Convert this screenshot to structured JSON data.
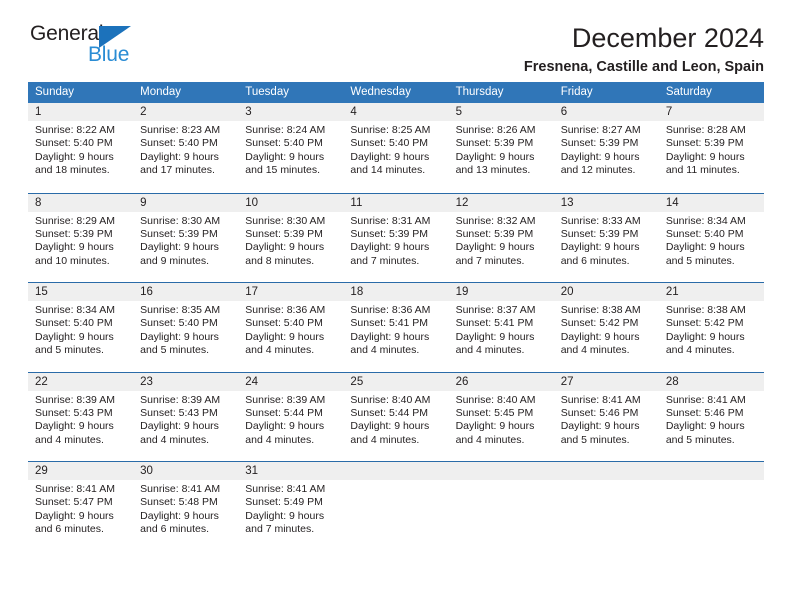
{
  "logo": {
    "text_top": "General",
    "text_bottom": "Blue",
    "triangle_color": "#1c72bb",
    "blue_color": "#2a8cd4"
  },
  "header": {
    "month_title": "December 2024",
    "location": "Fresnena, Castille and Leon, Spain"
  },
  "colors": {
    "header_band": "#3076b8",
    "row_divider": "#2a6ba8",
    "day_number_band": "#efefef",
    "text": "#231f20"
  },
  "calendar": {
    "weekdays": [
      "Sunday",
      "Monday",
      "Tuesday",
      "Wednesday",
      "Thursday",
      "Friday",
      "Saturday"
    ],
    "weeks": [
      [
        {
          "day": "1",
          "sunrise": "Sunrise: 8:22 AM",
          "sunset": "Sunset: 5:40 PM",
          "daylight_line1": "Daylight: 9 hours",
          "daylight_line2": "and 18 minutes."
        },
        {
          "day": "2",
          "sunrise": "Sunrise: 8:23 AM",
          "sunset": "Sunset: 5:40 PM",
          "daylight_line1": "Daylight: 9 hours",
          "daylight_line2": "and 17 minutes."
        },
        {
          "day": "3",
          "sunrise": "Sunrise: 8:24 AM",
          "sunset": "Sunset: 5:40 PM",
          "daylight_line1": "Daylight: 9 hours",
          "daylight_line2": "and 15 minutes."
        },
        {
          "day": "4",
          "sunrise": "Sunrise: 8:25 AM",
          "sunset": "Sunset: 5:40 PM",
          "daylight_line1": "Daylight: 9 hours",
          "daylight_line2": "and 14 minutes."
        },
        {
          "day": "5",
          "sunrise": "Sunrise: 8:26 AM",
          "sunset": "Sunset: 5:39 PM",
          "daylight_line1": "Daylight: 9 hours",
          "daylight_line2": "and 13 minutes."
        },
        {
          "day": "6",
          "sunrise": "Sunrise: 8:27 AM",
          "sunset": "Sunset: 5:39 PM",
          "daylight_line1": "Daylight: 9 hours",
          "daylight_line2": "and 12 minutes."
        },
        {
          "day": "7",
          "sunrise": "Sunrise: 8:28 AM",
          "sunset": "Sunset: 5:39 PM",
          "daylight_line1": "Daylight: 9 hours",
          "daylight_line2": "and 11 minutes."
        }
      ],
      [
        {
          "day": "8",
          "sunrise": "Sunrise: 8:29 AM",
          "sunset": "Sunset: 5:39 PM",
          "daylight_line1": "Daylight: 9 hours",
          "daylight_line2": "and 10 minutes."
        },
        {
          "day": "9",
          "sunrise": "Sunrise: 8:30 AM",
          "sunset": "Sunset: 5:39 PM",
          "daylight_line1": "Daylight: 9 hours",
          "daylight_line2": "and 9 minutes."
        },
        {
          "day": "10",
          "sunrise": "Sunrise: 8:30 AM",
          "sunset": "Sunset: 5:39 PM",
          "daylight_line1": "Daylight: 9 hours",
          "daylight_line2": "and 8 minutes."
        },
        {
          "day": "11",
          "sunrise": "Sunrise: 8:31 AM",
          "sunset": "Sunset: 5:39 PM",
          "daylight_line1": "Daylight: 9 hours",
          "daylight_line2": "and 7 minutes."
        },
        {
          "day": "12",
          "sunrise": "Sunrise: 8:32 AM",
          "sunset": "Sunset: 5:39 PM",
          "daylight_line1": "Daylight: 9 hours",
          "daylight_line2": "and 7 minutes."
        },
        {
          "day": "13",
          "sunrise": "Sunrise: 8:33 AM",
          "sunset": "Sunset: 5:39 PM",
          "daylight_line1": "Daylight: 9 hours",
          "daylight_line2": "and 6 minutes."
        },
        {
          "day": "14",
          "sunrise": "Sunrise: 8:34 AM",
          "sunset": "Sunset: 5:40 PM",
          "daylight_line1": "Daylight: 9 hours",
          "daylight_line2": "and 5 minutes."
        }
      ],
      [
        {
          "day": "15",
          "sunrise": "Sunrise: 8:34 AM",
          "sunset": "Sunset: 5:40 PM",
          "daylight_line1": "Daylight: 9 hours",
          "daylight_line2": "and 5 minutes."
        },
        {
          "day": "16",
          "sunrise": "Sunrise: 8:35 AM",
          "sunset": "Sunset: 5:40 PM",
          "daylight_line1": "Daylight: 9 hours",
          "daylight_line2": "and 5 minutes."
        },
        {
          "day": "17",
          "sunrise": "Sunrise: 8:36 AM",
          "sunset": "Sunset: 5:40 PM",
          "daylight_line1": "Daylight: 9 hours",
          "daylight_line2": "and 4 minutes."
        },
        {
          "day": "18",
          "sunrise": "Sunrise: 8:36 AM",
          "sunset": "Sunset: 5:41 PM",
          "daylight_line1": "Daylight: 9 hours",
          "daylight_line2": "and 4 minutes."
        },
        {
          "day": "19",
          "sunrise": "Sunrise: 8:37 AM",
          "sunset": "Sunset: 5:41 PM",
          "daylight_line1": "Daylight: 9 hours",
          "daylight_line2": "and 4 minutes."
        },
        {
          "day": "20",
          "sunrise": "Sunrise: 8:38 AM",
          "sunset": "Sunset: 5:42 PM",
          "daylight_line1": "Daylight: 9 hours",
          "daylight_line2": "and 4 minutes."
        },
        {
          "day": "21",
          "sunrise": "Sunrise: 8:38 AM",
          "sunset": "Sunset: 5:42 PM",
          "daylight_line1": "Daylight: 9 hours",
          "daylight_line2": "and 4 minutes."
        }
      ],
      [
        {
          "day": "22",
          "sunrise": "Sunrise: 8:39 AM",
          "sunset": "Sunset: 5:43 PM",
          "daylight_line1": "Daylight: 9 hours",
          "daylight_line2": "and 4 minutes."
        },
        {
          "day": "23",
          "sunrise": "Sunrise: 8:39 AM",
          "sunset": "Sunset: 5:43 PM",
          "daylight_line1": "Daylight: 9 hours",
          "daylight_line2": "and 4 minutes."
        },
        {
          "day": "24",
          "sunrise": "Sunrise: 8:39 AM",
          "sunset": "Sunset: 5:44 PM",
          "daylight_line1": "Daylight: 9 hours",
          "daylight_line2": "and 4 minutes."
        },
        {
          "day": "25",
          "sunrise": "Sunrise: 8:40 AM",
          "sunset": "Sunset: 5:44 PM",
          "daylight_line1": "Daylight: 9 hours",
          "daylight_line2": "and 4 minutes."
        },
        {
          "day": "26",
          "sunrise": "Sunrise: 8:40 AM",
          "sunset": "Sunset: 5:45 PM",
          "daylight_line1": "Daylight: 9 hours",
          "daylight_line2": "and 4 minutes."
        },
        {
          "day": "27",
          "sunrise": "Sunrise: 8:41 AM",
          "sunset": "Sunset: 5:46 PM",
          "daylight_line1": "Daylight: 9 hours",
          "daylight_line2": "and 5 minutes."
        },
        {
          "day": "28",
          "sunrise": "Sunrise: 8:41 AM",
          "sunset": "Sunset: 5:46 PM",
          "daylight_line1": "Daylight: 9 hours",
          "daylight_line2": "and 5 minutes."
        }
      ],
      [
        {
          "day": "29",
          "sunrise": "Sunrise: 8:41 AM",
          "sunset": "Sunset: 5:47 PM",
          "daylight_line1": "Daylight: 9 hours",
          "daylight_line2": "and 6 minutes."
        },
        {
          "day": "30",
          "sunrise": "Sunrise: 8:41 AM",
          "sunset": "Sunset: 5:48 PM",
          "daylight_line1": "Daylight: 9 hours",
          "daylight_line2": "and 6 minutes."
        },
        {
          "day": "31",
          "sunrise": "Sunrise: 8:41 AM",
          "sunset": "Sunset: 5:49 PM",
          "daylight_line1": "Daylight: 9 hours",
          "daylight_line2": "and 7 minutes."
        },
        {
          "day": "",
          "sunrise": "",
          "sunset": "",
          "daylight_line1": "",
          "daylight_line2": ""
        },
        {
          "day": "",
          "sunrise": "",
          "sunset": "",
          "daylight_line1": "",
          "daylight_line2": ""
        },
        {
          "day": "",
          "sunrise": "",
          "sunset": "",
          "daylight_line1": "",
          "daylight_line2": ""
        },
        {
          "day": "",
          "sunrise": "",
          "sunset": "",
          "daylight_line1": "",
          "daylight_line2": ""
        }
      ]
    ]
  }
}
